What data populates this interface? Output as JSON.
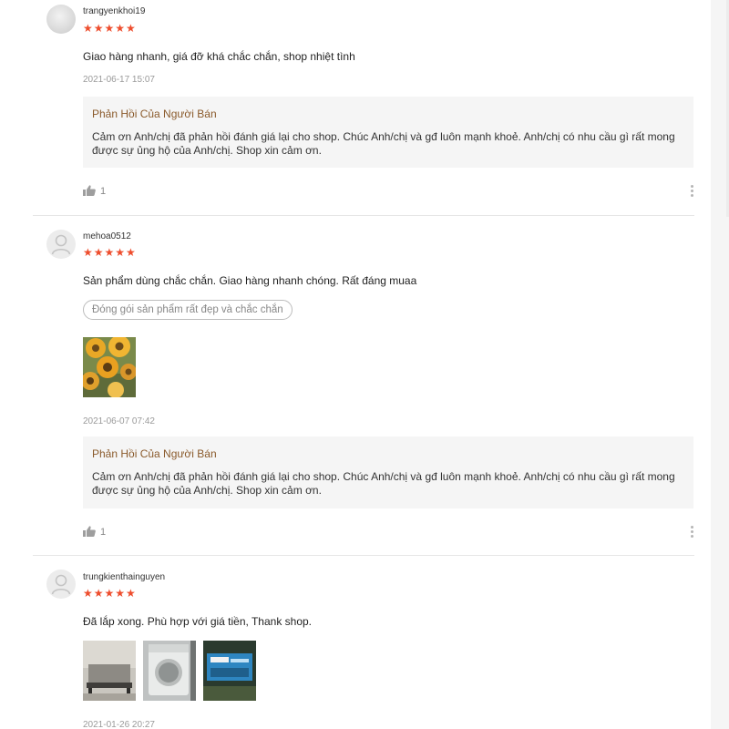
{
  "reviews": [
    {
      "username": "trangyenkhoi19",
      "stars": "★★★★★",
      "rating": 5,
      "comment": "Giao hàng nhanh, giá đỡ khá chắc chắn, shop nhiệt tình",
      "datetime": "2021-06-17 15:07",
      "reply": {
        "title": "Phản Hồi Của Người Bán",
        "text": "Cảm ơn Anh/chị đã phản hồi đánh giá lại cho shop. Chúc Anh/chị và gđ luôn mạnh khoẻ. Anh/chị có nhu cầu gì rất mong được sự ủng hộ của Anh/chị. Shop xin cảm ơn."
      },
      "likes": "1"
    },
    {
      "username": "mehoa0512",
      "stars": "★★★★★",
      "rating": 5,
      "comment": "Sản phẩm dùng chắc chắn. Giao hàng nhanh chóng. Rất đáng muaa",
      "tag": "Đóng gói sản phẩm rất đẹp và chắc chắn",
      "datetime": "2021-06-07 07:42",
      "reply": {
        "title": "Phản Hồi Của Người Bán",
        "text": "Cảm ơn Anh/chị đã phản hồi đánh giá lại cho shop. Chúc Anh/chị và gđ luôn mạnh khoẻ. Anh/chị có nhu cầu gì rất mong được sự ủng hộ của Anh/chị. Shop xin cảm ơn."
      },
      "likes": "1"
    },
    {
      "username": "trungkienthainguyen",
      "stars": "★★★★★",
      "rating": 5,
      "comment": "Đã lắp xong. Phù hợp với giá tiền, Thank shop.",
      "datetime": "2021-01-26 20:27"
    }
  ],
  "colors": {
    "star": "#ee4d2d",
    "reply_title": "#8a5a2b",
    "reply_bg": "#f5f5f5"
  }
}
